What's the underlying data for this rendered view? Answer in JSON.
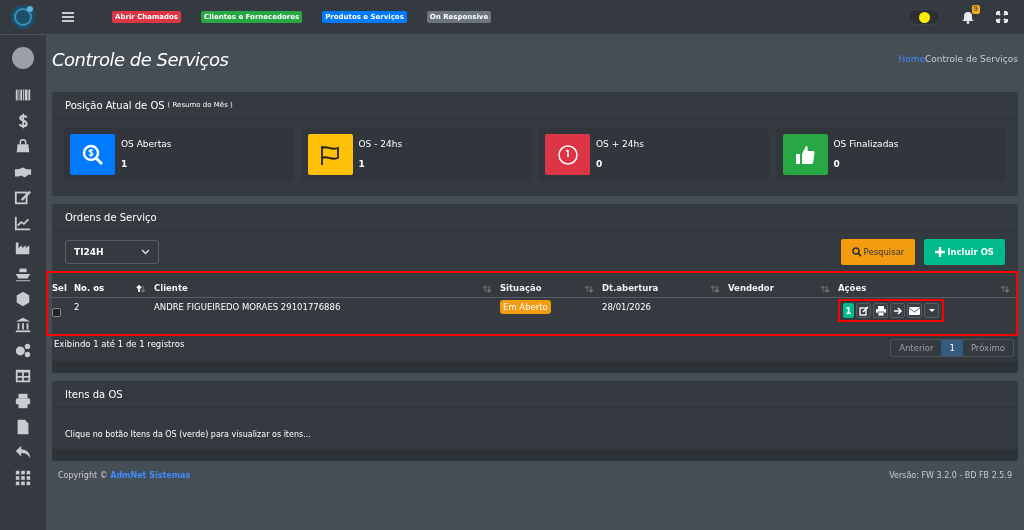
{
  "topbar": {
    "quick_links": [
      {
        "label": "Abrir Chamados",
        "color": "#dc3545"
      },
      {
        "label": "Clientes e Fornecedores",
        "color": "#28a745"
      },
      {
        "label": "Produtos e Serviços",
        "color": "#007bff"
      },
      {
        "label": "On Responsive",
        "color": "#6c757d"
      }
    ],
    "notification_count": "9",
    "dark_mode": true
  },
  "page_title": "Controle de Serviços",
  "breadcrumb": [
    "Home",
    "Controle de Serviços"
  ],
  "summary": {
    "title": "Posição Atual de OS",
    "subtitle": "( Resumo do Mês )",
    "boxes": [
      {
        "kind": "search",
        "label": "OS Abertas",
        "value": "1",
        "color": "#007bff"
      },
      {
        "kind": "flag",
        "label": "OS - 24hs",
        "value": "1",
        "color": "#ffc107"
      },
      {
        "kind": "clock",
        "label": "OS + 24hs",
        "value": "0",
        "color": "#dc3545"
      },
      {
        "kind": "thumbs",
        "label": "OS Finalizadas",
        "value": "0",
        "color": "#28a745"
      }
    ]
  },
  "orders": {
    "title": "Ordens de Serviço",
    "filter": "TI24H",
    "buttons": [
      {
        "kind": "search",
        "label": "Pesquisar"
      },
      {
        "kind": "add",
        "label": "Incluir OS"
      }
    ],
    "columns": [
      {
        "label": "Sel",
        "sortable": false,
        "sorted": false
      },
      {
        "label": "No. os",
        "sortable": true,
        "sorted": true
      },
      {
        "label": "Cliente",
        "sortable": true,
        "sorted": false
      },
      {
        "label": "Situação",
        "sortable": true,
        "sorted": false
      },
      {
        "label": "Dt.abertura",
        "sortable": true,
        "sorted": false
      },
      {
        "label": "Vendedor",
        "sortable": true,
        "sorted": false
      },
      {
        "label": "Ações",
        "sortable": true,
        "sorted": false
      }
    ],
    "rows": [
      {
        "checked": false,
        "number": "2",
        "client": "ANDRE FIGUEIREDO MORAES 29101776886",
        "status": "Em Aberto",
        "opened": "28/01/2026",
        "actions": [
          {
            "kind": "items",
            "label": "1"
          },
          {
            "kind": "edit"
          },
          {
            "kind": "print"
          },
          {
            "kind": "forward"
          },
          {
            "kind": "mail"
          },
          {
            "kind": "caret"
          }
        ]
      }
    ],
    "info": "Exibindo 1 até 1 de 1 registros",
    "pagination": [
      {
        "label": "Anterior",
        "selected": false,
        "disabled": true
      },
      {
        "label": "1",
        "selected": true,
        "disabled": false
      },
      {
        "label": "Próximo",
        "selected": false,
        "disabled": true
      }
    ]
  },
  "items": {
    "title": "Itens da OS",
    "hint": "Clique no botão Itens da OS (verde) para visualizar os itens..."
  },
  "footer": {
    "copyright": "Copyright ©",
    "company": "AdmNet Sistemas",
    "version": "Versão: FW 3.2.0 - BD FB 2.5.9"
  }
}
